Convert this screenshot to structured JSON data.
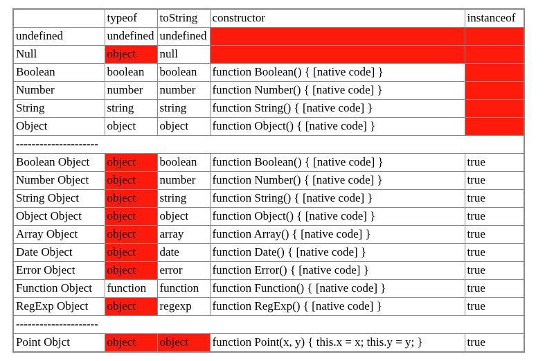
{
  "headers": [
    "",
    "typeof",
    "toString",
    "constructor",
    "instanceof"
  ],
  "separator": "---------------------",
  "highlight_color": "#ff1b0c",
  "rows": [
    {
      "label": "undefined",
      "typeof": "undefined",
      "typeof_hl": false,
      "toString": "undefined",
      "toString_hl": false,
      "constructor": "",
      "constructor_hl": true,
      "instanceof": "",
      "instanceof_hl": true
    },
    {
      "label": "Null",
      "typeof": "object",
      "typeof_hl": true,
      "toString": "null",
      "toString_hl": false,
      "constructor": "",
      "constructor_hl": true,
      "instanceof": "",
      "instanceof_hl": true
    },
    {
      "label": "Boolean",
      "typeof": "boolean",
      "typeof_hl": false,
      "toString": "boolean",
      "toString_hl": false,
      "constructor": "function Boolean() { [native code] }",
      "constructor_hl": false,
      "instanceof": "",
      "instanceof_hl": true
    },
    {
      "label": "Number",
      "typeof": "number",
      "typeof_hl": false,
      "toString": "number",
      "toString_hl": false,
      "constructor": "function Number() { [native code] }",
      "constructor_hl": false,
      "instanceof": "",
      "instanceof_hl": true
    },
    {
      "label": "String",
      "typeof": "string",
      "typeof_hl": false,
      "toString": "string",
      "toString_hl": false,
      "constructor": "function String() { [native code] }",
      "constructor_hl": false,
      "instanceof": "",
      "instanceof_hl": true
    },
    {
      "label": "Object",
      "typeof": "object",
      "typeof_hl": false,
      "toString": "object",
      "toString_hl": false,
      "constructor": "function Object() { [native code] }",
      "constructor_hl": false,
      "instanceof": "",
      "instanceof_hl": true
    },
    {
      "sep": true
    },
    {
      "label": "Boolean Object",
      "typeof": "object",
      "typeof_hl": true,
      "toString": "boolean",
      "toString_hl": false,
      "constructor": "function Boolean() { [native code] }",
      "constructor_hl": false,
      "instanceof": "true",
      "instanceof_hl": false
    },
    {
      "label": "Number Object",
      "typeof": "object",
      "typeof_hl": true,
      "toString": "number",
      "toString_hl": false,
      "constructor": "function Number() { [native code] }",
      "constructor_hl": false,
      "instanceof": "true",
      "instanceof_hl": false
    },
    {
      "label": "String Object",
      "typeof": "object",
      "typeof_hl": true,
      "toString": "string",
      "toString_hl": false,
      "constructor": "function String() { [native code] }",
      "constructor_hl": false,
      "instanceof": "true",
      "instanceof_hl": false
    },
    {
      "label": "Object Object",
      "typeof": "object",
      "typeof_hl": true,
      "toString": "object",
      "toString_hl": false,
      "constructor": "function Object() { [native code] }",
      "constructor_hl": false,
      "instanceof": "true",
      "instanceof_hl": false
    },
    {
      "label": "Array Object",
      "typeof": "object",
      "typeof_hl": true,
      "toString": "array",
      "toString_hl": false,
      "constructor": "function Array() { [native code] }",
      "constructor_hl": false,
      "instanceof": "true",
      "instanceof_hl": false
    },
    {
      "label": "Date Object",
      "typeof": "object",
      "typeof_hl": true,
      "toString": "date",
      "toString_hl": false,
      "constructor": "function Date() { [native code] }",
      "constructor_hl": false,
      "instanceof": "true",
      "instanceof_hl": false
    },
    {
      "label": "Error Object",
      "typeof": "object",
      "typeof_hl": true,
      "toString": "error",
      "toString_hl": false,
      "constructor": "function Error() { [native code] }",
      "constructor_hl": false,
      "instanceof": "true",
      "instanceof_hl": false
    },
    {
      "label": "Function Object",
      "typeof": "function",
      "typeof_hl": false,
      "toString": "function",
      "toString_hl": false,
      "constructor": "function Function() { [native code] }",
      "constructor_hl": false,
      "instanceof": "true",
      "instanceof_hl": false
    },
    {
      "label": "RegExp Object",
      "typeof": "object",
      "typeof_hl": true,
      "toString": "regexp",
      "toString_hl": false,
      "constructor": "function RegExp() { [native code] }",
      "constructor_hl": false,
      "instanceof": "true",
      "instanceof_hl": false
    },
    {
      "sep": true
    },
    {
      "label": "Point Objct",
      "typeof": "object",
      "typeof_hl": true,
      "toString": "object",
      "toString_hl": true,
      "constructor": "function Point(x, y) { this.x = x; this.y = y; }",
      "constructor_hl": false,
      "instanceof": "true",
      "instanceof_hl": false
    }
  ]
}
